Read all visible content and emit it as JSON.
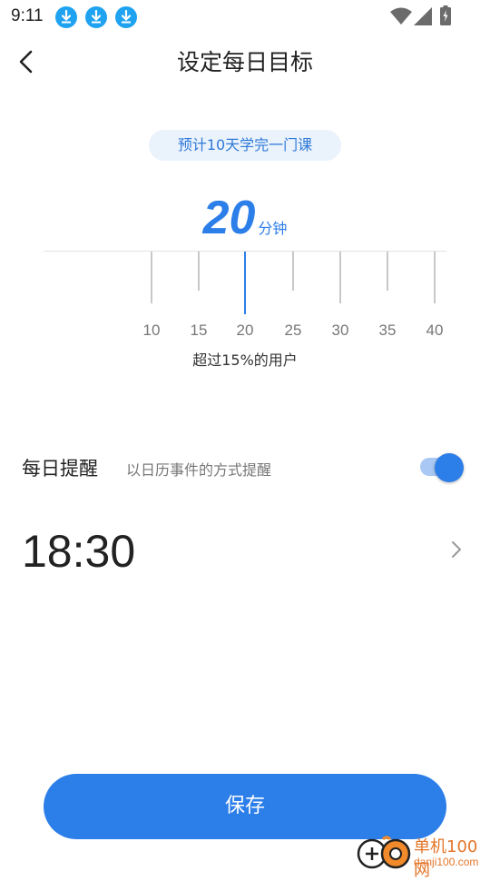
{
  "status_bar": {
    "time": "9:11",
    "icons": [
      "download-icon",
      "download-icon",
      "download-icon",
      "wifi-icon",
      "signal-icon",
      "battery-icon"
    ]
  },
  "header": {
    "title": "设定每日目标",
    "back_icon": "back-chevron-icon"
  },
  "goal": {
    "estimate_text": "预计10天学完一门课",
    "value": "20",
    "unit": "分钟",
    "ruler_ticks": [
      "10",
      "15",
      "20",
      "25",
      "30",
      "35",
      "40"
    ],
    "selected_tick": "20",
    "caption": "超过15%的用户"
  },
  "reminder": {
    "title": "每日提醒",
    "subtitle": "以日历事件的方式提醒",
    "enabled": true,
    "time": "18:30",
    "chevron_icon": "chevron-right-icon"
  },
  "save_label": "保存",
  "watermark": {
    "line1": "单机100网",
    "line2": "danji100.com"
  },
  "colors": {
    "accent": "#2c7ee8",
    "pill_bg": "#eaf2fc"
  }
}
